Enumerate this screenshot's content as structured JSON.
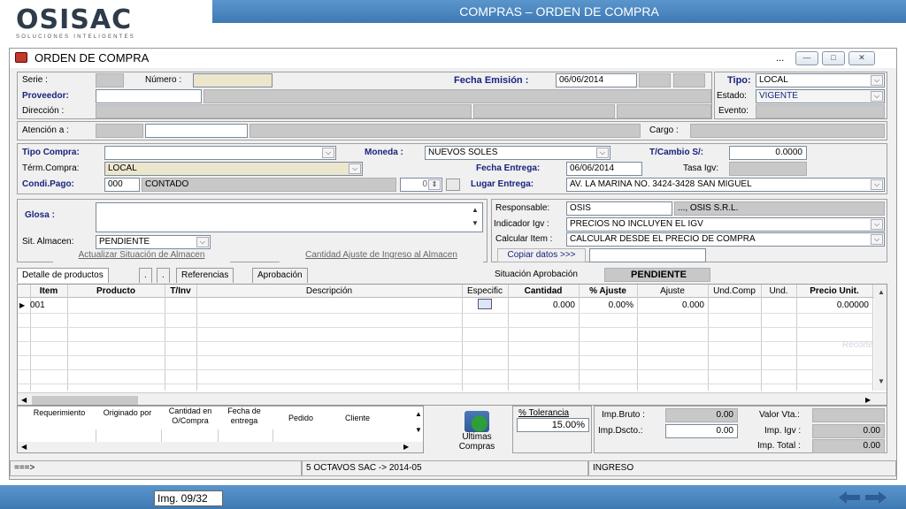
{
  "slide": {
    "title": "COMPRAS – ORDEN DE COMPRA",
    "logo_main": "OSISAC",
    "logo_sub": "SOLUCIONES INTELIGENTES",
    "img_label": "Img. 09/32"
  },
  "window": {
    "title": "ORDEN DE COMPRA",
    "ellipsis": "..."
  },
  "header": {
    "serie_label": "Serie :",
    "numero_label": "Número :",
    "fecha_emision_label": "Fecha Emisión :",
    "fecha_emision": "06/06/2014",
    "tipo_label": "Tipo:",
    "tipo": "LOCAL",
    "proveedor_label": "Proveedor:",
    "estado_label": "Estado:",
    "estado": "VIGENTE",
    "direccion_label": "Dirección :",
    "evento_label": "Evento:",
    "atencion_label": "Atención a :",
    "cargo_label": "Cargo :"
  },
  "terms": {
    "tipo_compra_label": "Tipo Compra:",
    "moneda_label": "Moneda :",
    "moneda": "NUEVOS SOLES",
    "tcambio_label": "T/Cambio S/:",
    "tcambio": "0.0000",
    "term_compra_label": "Térm.Compra:",
    "term_compra": "LOCAL",
    "fecha_entrega_label": "Fecha Entrega:",
    "fecha_entrega": "06/06/2014",
    "tasa_igv_label": "Tasa Igv:",
    "condi_pago_label": "Condi.Pago:",
    "condi_code": "000",
    "condi_pago": "CONTADO",
    "spinner_value": "0",
    "lugar_entrega_label": "Lugar Entrega:",
    "lugar_entrega": "AV. LA MARINA NO. 3424-3428 SAN MIGUEL"
  },
  "glosa": {
    "glosa_label": "Glosa :",
    "sit_almacen_label": "Sit. Almacen:",
    "sit_almacen": "PENDIENTE",
    "btn_actualizar": "Actualizar Situación de Almacen",
    "btn_cantidad": "Cantidad Ajuste de Ingreso al Almacen",
    "responsable_label": "Responsable:",
    "responsable": "OSIS",
    "responsable_name": "..., OSIS S.R.L.",
    "indicador_label": "Indicador Igv :",
    "indicador": "PRECIOS NO INCLUYEN EL IGV",
    "calcular_label": "Calcular Item :",
    "calcular": "CALCULAR DESDE EL PRECIO DE COMPRA",
    "copiar": "Copiar datos >>>",
    "situacion_label": "Situación Aprobación",
    "situacion": "PENDIENTE"
  },
  "tabs": [
    "Detalle de productos",
    ".",
    ".",
    "Referencias",
    "Aprobación"
  ],
  "grid": {
    "columns": [
      "Item",
      "Producto",
      "T/Inv",
      "Descripción",
      "Especific",
      "Cantidad",
      "% Ajuste",
      "Ajuste",
      "Und.Comp",
      "Und.",
      "Precio Unit."
    ],
    "row": {
      "item": "001",
      "cantidad": "0.000",
      "ajuste_pct": "0.00%",
      "ajuste": "0.000",
      "precio": "0.00000"
    },
    "ghost": "Recorte rect"
  },
  "subgrid": {
    "columns": [
      "Requerimiento",
      "Originado por",
      "Cantidad en O/Compra",
      "Fecha de entrega",
      "Pedido",
      "Cliente"
    ]
  },
  "totals": {
    "ultimas": "Ultimas Compras",
    "tolerancia_label": "% Tolerancia",
    "tolerancia": "15.00%",
    "imp_bruto_label": "Imp.Bruto :",
    "imp_bruto": "0.00",
    "imp_dscto_label": "Imp.Dscto.:",
    "imp_dscto": "0.00",
    "valor_vta_label": "Valor Vta.:",
    "imp_igv_label": "Imp. Igv :",
    "imp_igv": "0.00",
    "imp_total_label": "Imp. Total :",
    "imp_total": "0.00"
  },
  "statusbar": {
    "left": "===>",
    "middle": "5 OCTAVOS SAC -> 2014-05",
    "right": "INGRESO"
  }
}
